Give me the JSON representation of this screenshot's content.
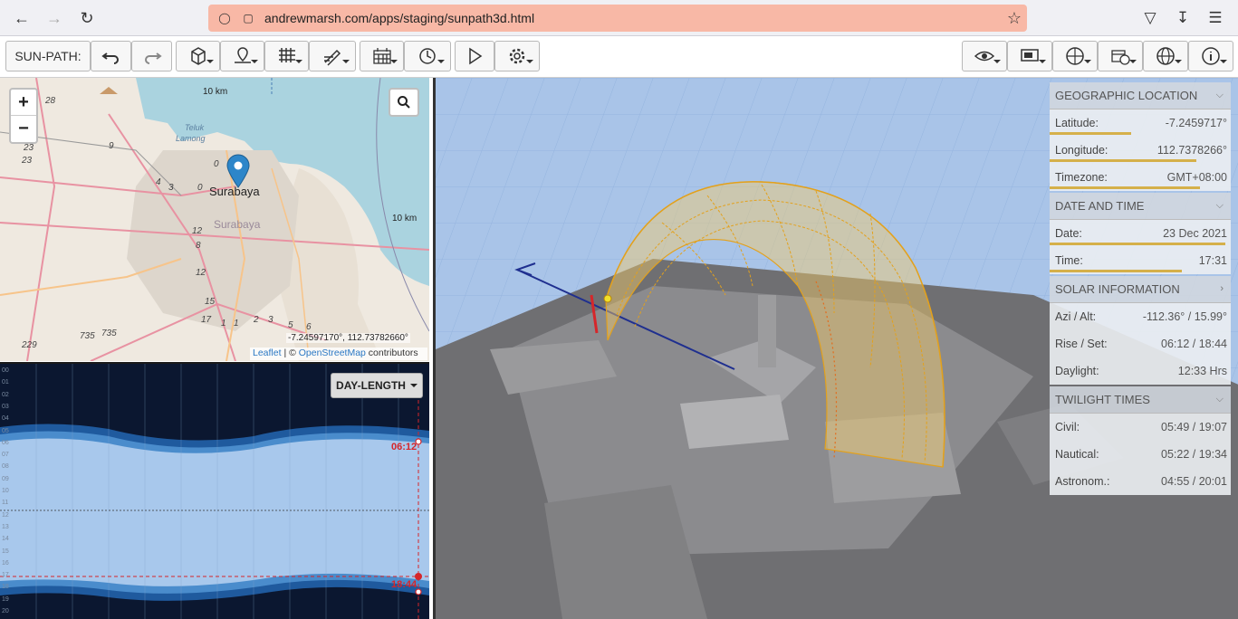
{
  "browser": {
    "url": "andrewmarsh.com/apps/staging/sunpath3d.html"
  },
  "toolbar": {
    "app_label": "SUN-PATH:"
  },
  "map": {
    "scale_top": "10 km",
    "scale_right": "10 km",
    "city": "Surabaya",
    "city_secondary": "Surabaya",
    "coords": "-7.24597170°, 112.73782660°",
    "attribution_leaflet": "Leaflet",
    "attribution_sep": " | © ",
    "attribution_osm": "OpenStreetMap",
    "attribution_contrib": " contributors",
    "place_teluk": "Teluk",
    "place_lamong": "Lamong",
    "road_numbers": [
      "28",
      "23",
      "23",
      "9",
      "4",
      "3",
      "0",
      "0",
      "12",
      "8",
      "12",
      "15",
      "17",
      "1",
      "1",
      "2",
      "3",
      "5",
      "6",
      "735",
      "735",
      "229"
    ]
  },
  "daylength": {
    "button": "DAY-LENGTH",
    "hours": [
      "00",
      "01",
      "02",
      "03",
      "04",
      "05",
      "06",
      "07",
      "08",
      "09",
      "10",
      "11",
      "12",
      "13",
      "14",
      "15",
      "16",
      "17",
      "18",
      "19",
      "20"
    ],
    "rise": "06:12",
    "set": "18:44"
  },
  "panel": {
    "geo": {
      "title": "GEOGRAPHIC LOCATION",
      "rows": [
        {
          "label": "Latitude:",
          "value": "-7.2459717°",
          "fill": 0.45
        },
        {
          "label": "Longitude:",
          "value": "112.7378266°",
          "fill": 0.81
        },
        {
          "label": "Timezone:",
          "value": "GMT+08:00",
          "fill": 0.83
        }
      ]
    },
    "dt": {
      "title": "DATE AND TIME",
      "rows": [
        {
          "label": "Date:",
          "value": "23 Dec 2021",
          "fill": 0.97
        },
        {
          "label": "Time:",
          "value": "17:31",
          "fill": 0.73
        }
      ]
    },
    "solar": {
      "title": "SOLAR INFORMATION",
      "rows": [
        {
          "label": "Azi / Alt:",
          "value": "-112.36° / 15.99°"
        },
        {
          "label": "Rise / Set:",
          "value": "06:12 / 18:44"
        },
        {
          "label": "Daylight:",
          "value": "12:33 Hrs"
        }
      ]
    },
    "twi": {
      "title": "TWILIGHT TIMES",
      "rows": [
        {
          "label": "Civil:",
          "value": "05:49 / 19:07"
        },
        {
          "label": "Nautical:",
          "value": "05:22 / 19:34"
        },
        {
          "label": "Astronom.:",
          "value": "04:55 / 20:01"
        }
      ]
    }
  }
}
